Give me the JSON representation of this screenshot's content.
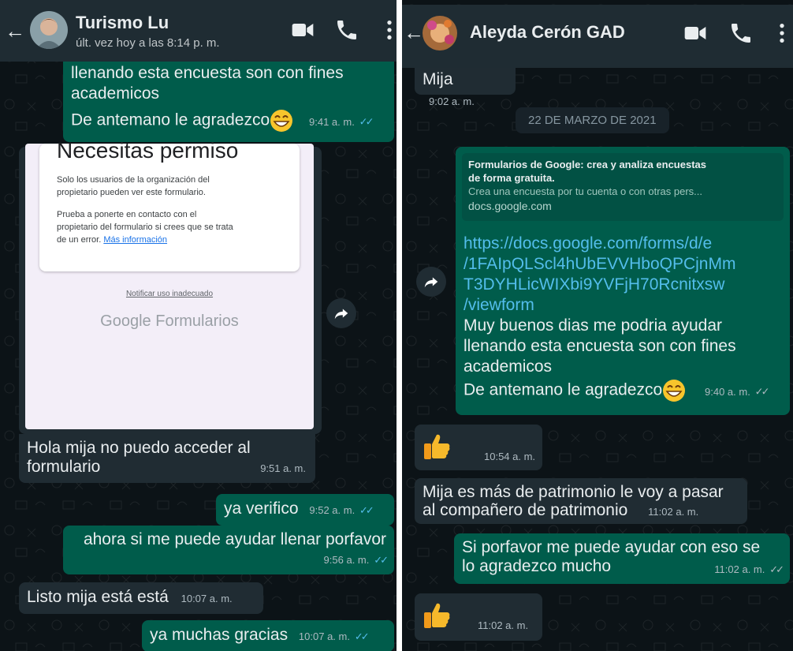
{
  "left": {
    "contact_name": "Turismo Lu",
    "last_seen": "últ. vez hoy a las 8:14 p. m.",
    "messages": {
      "m1_line1": "llenando esta encuesta son con fines",
      "m1_line2": "academicos",
      "m1_line3": "De antemano le agradezco",
      "m1_time": "9:41 a. m.",
      "m2_line1": "Hola mija no puedo acceder al",
      "m2_line2": "formulario",
      "m2_time": "9:51 a. m.",
      "m3_text": "ya verifico",
      "m3_time": "9:52 a. m.",
      "m4_text": "ahora si me puede ayudar llenar porfavor",
      "m4_time": "9:56 a. m.",
      "m5_text": "Listo mija está está",
      "m5_time": "10:07 a. m.",
      "m6_text": "ya muchas gracias",
      "m6_time": "10:07 a. m."
    },
    "form_screenshot": {
      "heading": "Necesitas permiso",
      "para1_line1": "Solo los usuarios de la organización del",
      "para1_line2": "propietario pueden ver este formulario.",
      "para2_line1": "Prueba a ponerte en contacto con el",
      "para2_line2": "propietario del formulario si crees que se trata",
      "para2_line3": "de un error.",
      "more_info": "Más información",
      "report": "Notificar uso inadecuado",
      "brand_google": "Google",
      "brand_forms": "Formularios"
    }
  },
  "right": {
    "contact_name": "Aleyda Cerón GAD",
    "messages": {
      "r1_text": "Mija",
      "r1_time": "9:02 a. m.",
      "date_chip": "22 DE MARZO DE 2021",
      "preview_title1": "Formularios de Google: crea y analiza encuestas",
      "preview_title2": "de forma gratuita.",
      "preview_desc": "Crea una encuesta por tu cuenta o con otras pers...",
      "preview_domain": "docs.google.com",
      "link1": "https://docs.google.com/forms/d/e",
      "link2": "/1FAIpQLScl4hUbEVVHboQPCjnMm",
      "link3": "T3DYHLicWIXbi9YVFjH70Rcnitxsw",
      "link4": "/viewform",
      "body1": "Muy buenos dias me podria ayudar",
      "body2": "llenando esta encuesta son con fines",
      "body3": "academicos",
      "body4": "De antemano le agradezco",
      "r2_time": "9:40 a. m.",
      "r3_time": "10:54 a. m.",
      "r4_line1": "Mija es más de patrimonio le voy a pasar",
      "r4_line2": "al compañero de patrimonio",
      "r4_time": "11:02 a. m.",
      "r5_line1": "Si porfavor me puede ayudar con eso se",
      "r5_line2": "lo agradezco mucho",
      "r5_time": "11:02 a. m.",
      "r6_time": "11:02 a. m."
    }
  },
  "icons": {
    "back": "back-arrow-icon",
    "video": "video-call-icon",
    "call": "phone-call-icon",
    "menu": "more-options-icon",
    "forward": "forward-icon",
    "thumbs": "thumbs-up-emoji",
    "grin": "grinning-emoji"
  },
  "colors": {
    "header": "#1f2c33",
    "chat_bg": "#0c1317",
    "incoming": "#202c33",
    "outgoing": "#005c4b",
    "link": "#53bdeb"
  }
}
